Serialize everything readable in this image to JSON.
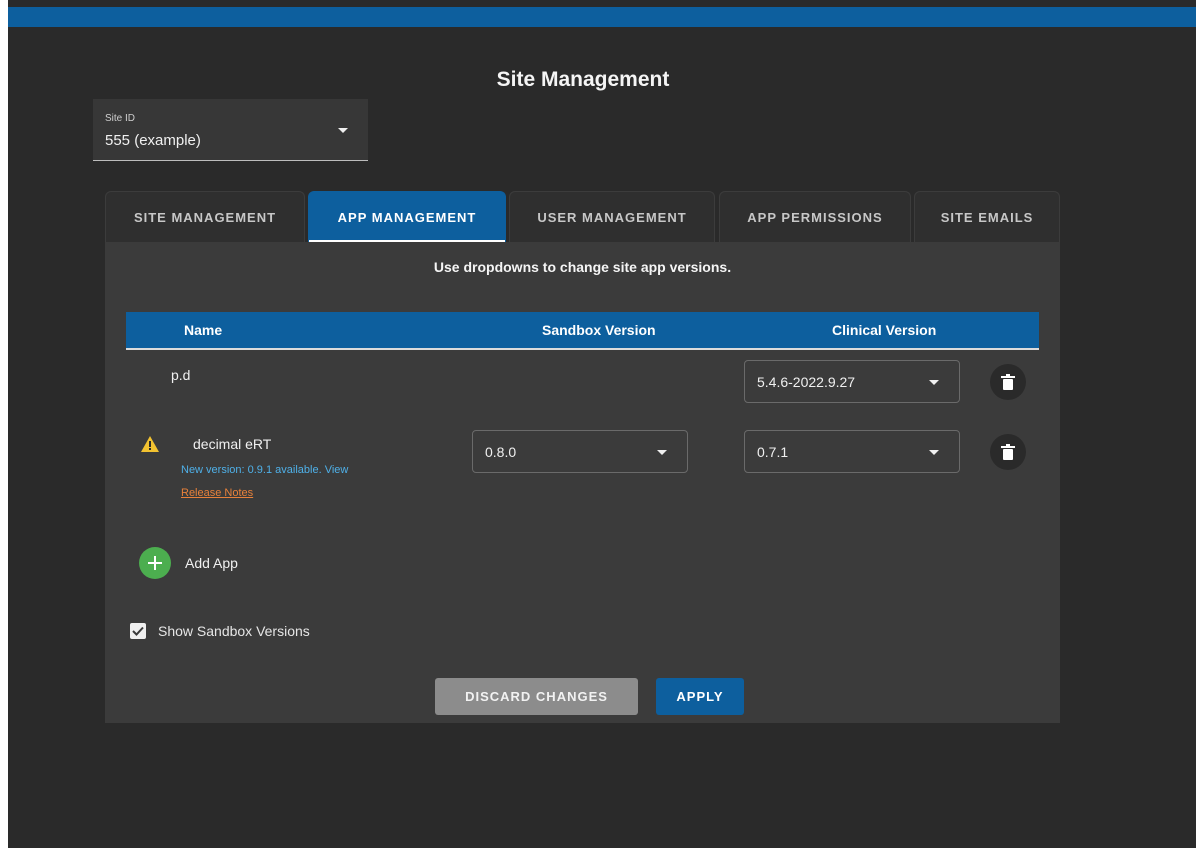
{
  "header": {
    "title": "Site Management"
  },
  "site_select": {
    "label": "Site ID",
    "value": "555 (example)"
  },
  "tabs": [
    {
      "label": "SITE MANAGEMENT",
      "active": false
    },
    {
      "label": "APP MANAGEMENT",
      "active": true
    },
    {
      "label": "USER MANAGEMENT",
      "active": false
    },
    {
      "label": "APP PERMISSIONS",
      "active": false
    },
    {
      "label": "SITE EMAILS",
      "active": false
    }
  ],
  "panel": {
    "hint": "Use dropdowns to change site app versions.",
    "columns": {
      "name": "Name",
      "sandbox": "Sandbox Version",
      "clinical": "Clinical Version"
    },
    "rows": [
      {
        "name": "p.d",
        "sandbox": "",
        "clinical": "5.4.6-2022.9.27"
      },
      {
        "name": "decimal eRT",
        "sandbox": "0.8.0",
        "clinical": "0.7.1",
        "update_note": "New version: 0.9.1 available. View",
        "release_link": "Release Notes"
      }
    ],
    "add_app_label": "Add App",
    "show_sandbox": {
      "label": "Show Sandbox Versions",
      "checked": true
    },
    "discard_label": "DISCARD CHANGES",
    "apply_label": "APPLY"
  },
  "colors": {
    "accent": "#0d5f9e",
    "background": "#2a2a2a",
    "panel": "#3b3b3b",
    "warning": "#f2c230",
    "add": "#4cae4f",
    "link": "#4fb0e8",
    "release_link": "#e8813a"
  },
  "icons": {
    "dropdown": "chevron-down-icon",
    "delete": "trash-icon",
    "warning": "warning-icon",
    "add": "plus-icon",
    "checkbox": "check-icon"
  }
}
